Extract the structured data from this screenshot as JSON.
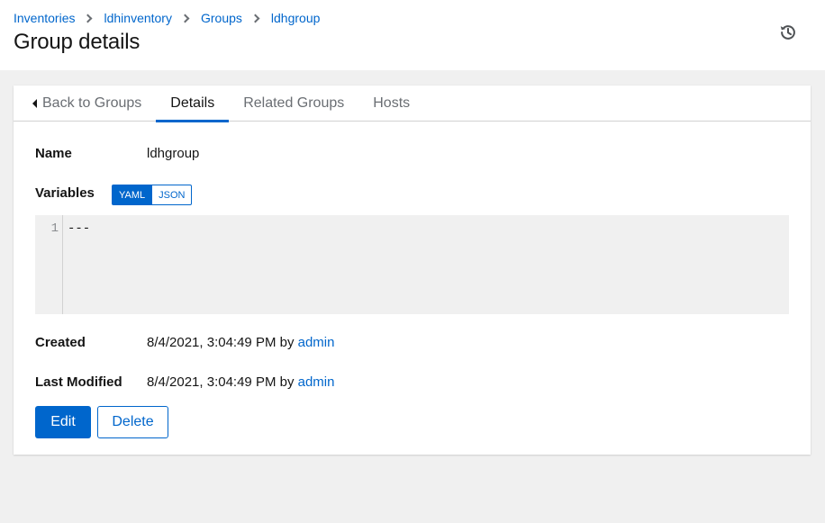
{
  "header": {
    "breadcrumb": [
      "Inventories",
      "ldhinventory",
      "Groups",
      "ldhgroup"
    ],
    "title": "Group details",
    "history_icon": "history-icon"
  },
  "tabs": [
    {
      "label": "Back to Groups",
      "icon": "caret-left-icon"
    },
    {
      "label": "Details",
      "active": true
    },
    {
      "label": "Related Groups"
    },
    {
      "label": "Hosts"
    }
  ],
  "details": {
    "name_label": "Name",
    "name_value": "ldhgroup",
    "variables_label": "Variables",
    "toggle_yaml": "YAML",
    "toggle_json": "JSON",
    "code_line_number": "1",
    "code_line_text": "---",
    "created_label": "Created",
    "created_value": "8/4/2021, 3:04:49 PM by",
    "created_user": "admin",
    "modified_label": "Last Modified",
    "modified_value": "8/4/2021, 3:04:49 PM by",
    "modified_user": "admin"
  },
  "actions": {
    "edit_label": "Edit",
    "delete_label": "Delete"
  },
  "colors": {
    "link": "#0066cc",
    "primary": "#0066cc",
    "page_bg": "#f0f0f0"
  }
}
